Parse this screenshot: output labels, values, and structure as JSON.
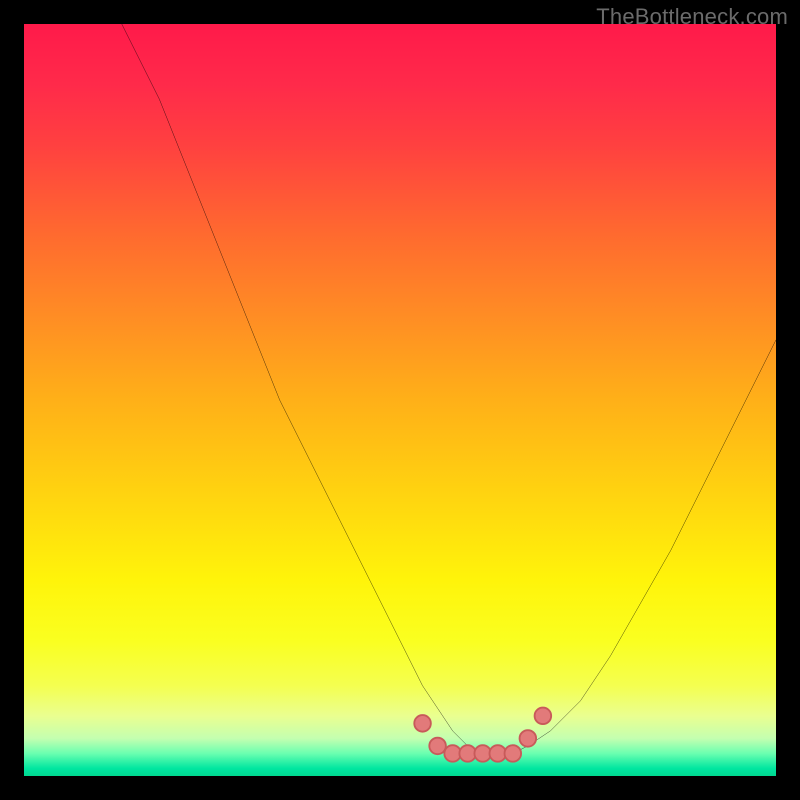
{
  "watermark": "TheBottleneck.com",
  "colors": {
    "frame": "#000000",
    "watermark_text": "#6b6b6b",
    "curve_stroke": "#000000",
    "marker_fill": "#e27a7a",
    "marker_stroke": "#c85a5a",
    "gradient_top": "#ff1a4a",
    "gradient_bottom": "#00d890"
  },
  "chart_data": {
    "type": "line",
    "title": "",
    "xlabel": "",
    "ylabel": "",
    "xlim": [
      0,
      100
    ],
    "ylim": [
      0,
      100
    ],
    "grid": false,
    "legend": false,
    "series": [
      {
        "name": "bottleneck-curve",
        "x": [
          13,
          18,
          22,
          26,
          30,
          34,
          38,
          42,
          46,
          50,
          53,
          55,
          57,
          59,
          61,
          63,
          65,
          67,
          70,
          74,
          78,
          82,
          86,
          90,
          94,
          98,
          100
        ],
        "y": [
          100,
          90,
          80,
          70,
          60,
          50,
          42,
          34,
          26,
          18,
          12,
          9,
          6,
          4,
          3,
          3,
          3,
          4,
          6,
          10,
          16,
          23,
          30,
          38,
          46,
          54,
          58
        ]
      }
    ],
    "markers": {
      "name": "bottom-markers",
      "x": [
        53,
        55,
        57,
        59,
        61,
        63,
        65,
        67,
        69
      ],
      "y": [
        7,
        4,
        3,
        3,
        3,
        3,
        3,
        5,
        8
      ]
    },
    "background_gradient": {
      "orientation": "vertical",
      "stops": [
        {
          "pos": 0.0,
          "color": "#ff1a4a"
        },
        {
          "pos": 0.28,
          "color": "#ff6a2f"
        },
        {
          "pos": 0.62,
          "color": "#ffd210"
        },
        {
          "pos": 0.88,
          "color": "#f4ff50"
        },
        {
          "pos": 0.97,
          "color": "#6affb0"
        },
        {
          "pos": 1.0,
          "color": "#00d890"
        }
      ]
    }
  }
}
